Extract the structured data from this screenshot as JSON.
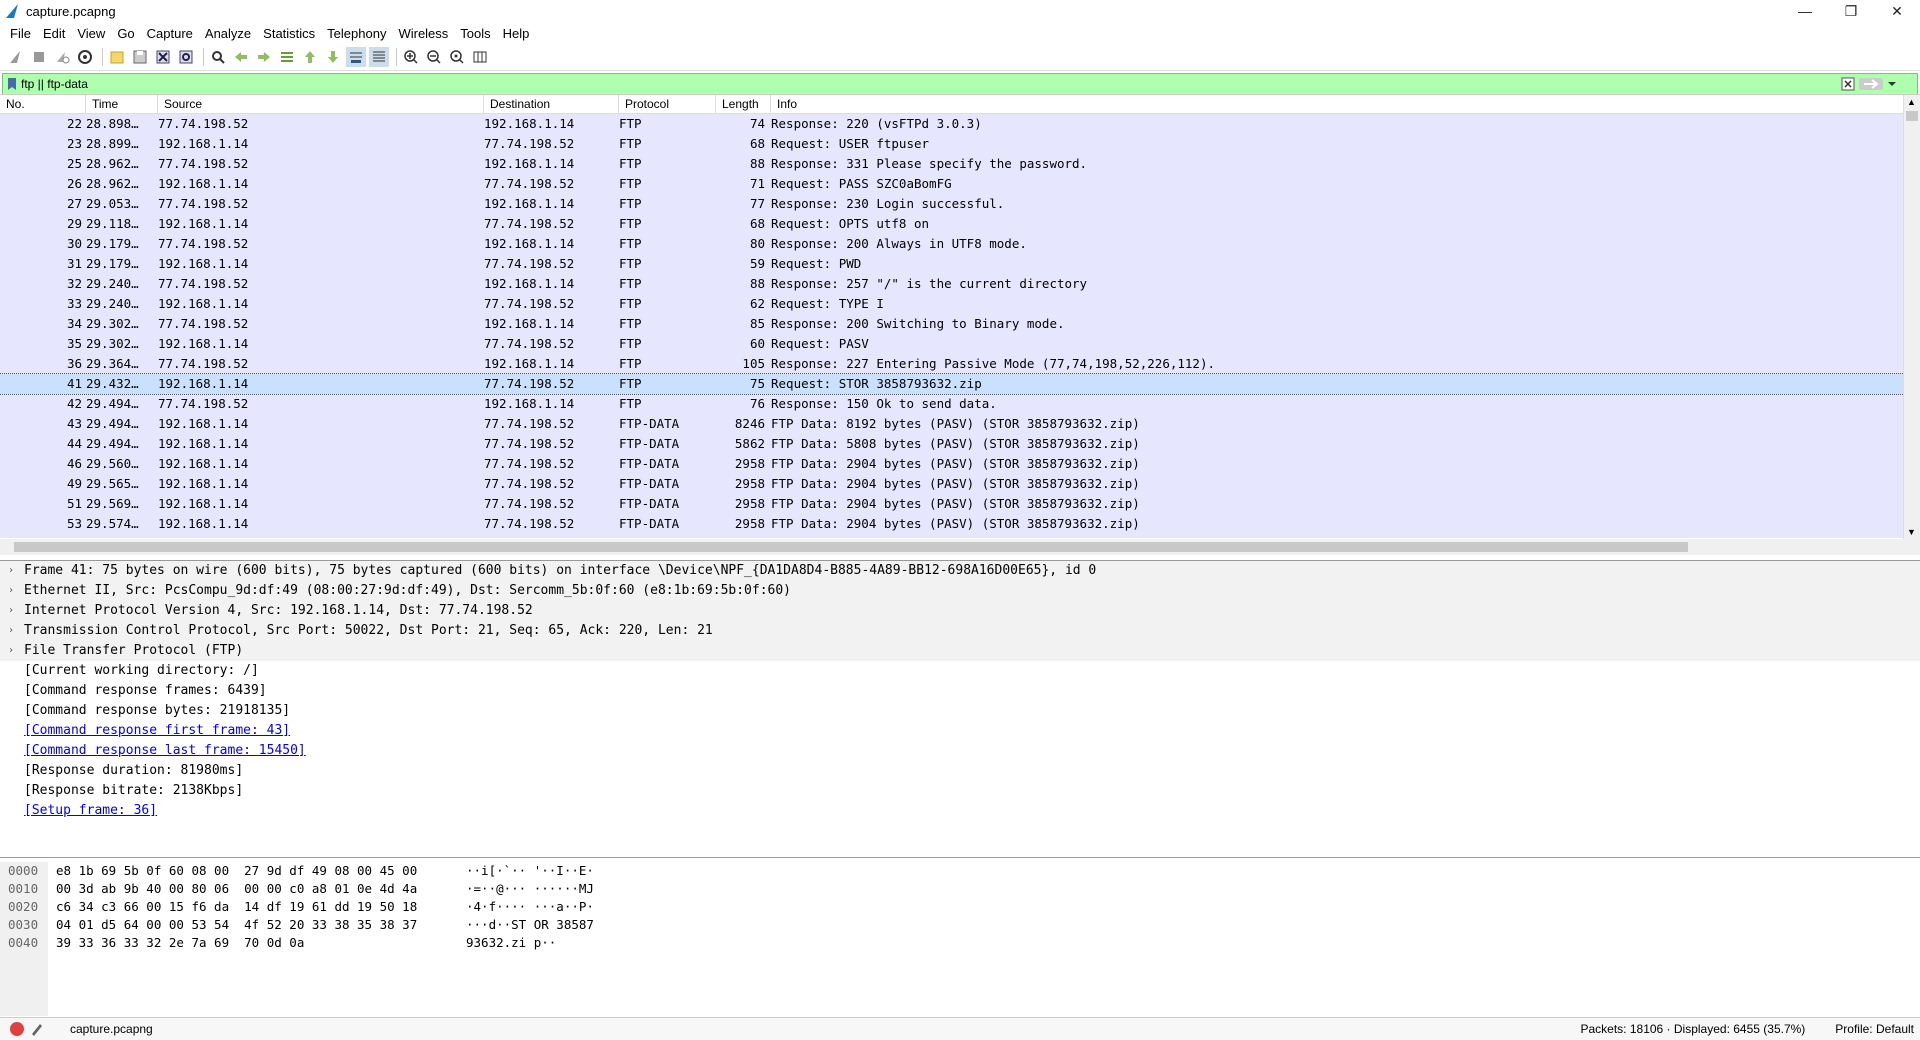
{
  "window": {
    "title": "capture.pcapng",
    "minimize": "—",
    "maximize": "❐",
    "close": "✕"
  },
  "menu": [
    "File",
    "Edit",
    "View",
    "Go",
    "Capture",
    "Analyze",
    "Statistics",
    "Telephony",
    "Wireless",
    "Tools",
    "Help"
  ],
  "filter": {
    "value": "ftp || ftp-data",
    "plus": "+"
  },
  "columns": [
    "No.",
    "Time",
    "Source",
    "Destination",
    "Protocol",
    "Length",
    "Info"
  ],
  "packets": [
    {
      "no": "22",
      "time": "28.898…",
      "src": "77.74.198.52",
      "dst": "192.168.1.14",
      "proto": "FTP",
      "len": "74",
      "info": "Response: 220 (vsFTPd 3.0.3)"
    },
    {
      "no": "23",
      "time": "28.899…",
      "src": "192.168.1.14",
      "dst": "77.74.198.52",
      "proto": "FTP",
      "len": "68",
      "info": "Request: USER ftpuser"
    },
    {
      "no": "25",
      "time": "28.962…",
      "src": "77.74.198.52",
      "dst": "192.168.1.14",
      "proto": "FTP",
      "len": "88",
      "info": "Response: 331 Please specify the password."
    },
    {
      "no": "26",
      "time": "28.962…",
      "src": "192.168.1.14",
      "dst": "77.74.198.52",
      "proto": "FTP",
      "len": "71",
      "info": "Request: PASS SZC0aBomFG"
    },
    {
      "no": "27",
      "time": "29.053…",
      "src": "77.74.198.52",
      "dst": "192.168.1.14",
      "proto": "FTP",
      "len": "77",
      "info": "Response: 230 Login successful."
    },
    {
      "no": "29",
      "time": "29.118…",
      "src": "192.168.1.14",
      "dst": "77.74.198.52",
      "proto": "FTP",
      "len": "68",
      "info": "Request: OPTS utf8 on"
    },
    {
      "no": "30",
      "time": "29.179…",
      "src": "77.74.198.52",
      "dst": "192.168.1.14",
      "proto": "FTP",
      "len": "80",
      "info": "Response: 200 Always in UTF8 mode."
    },
    {
      "no": "31",
      "time": "29.179…",
      "src": "192.168.1.14",
      "dst": "77.74.198.52",
      "proto": "FTP",
      "len": "59",
      "info": "Request: PWD"
    },
    {
      "no": "32",
      "time": "29.240…",
      "src": "77.74.198.52",
      "dst": "192.168.1.14",
      "proto": "FTP",
      "len": "88",
      "info": "Response: 257 \"/\" is the current directory"
    },
    {
      "no": "33",
      "time": "29.240…",
      "src": "192.168.1.14",
      "dst": "77.74.198.52",
      "proto": "FTP",
      "len": "62",
      "info": "Request: TYPE I"
    },
    {
      "no": "34",
      "time": "29.302…",
      "src": "77.74.198.52",
      "dst": "192.168.1.14",
      "proto": "FTP",
      "len": "85",
      "info": "Response: 200 Switching to Binary mode."
    },
    {
      "no": "35",
      "time": "29.302…",
      "src": "192.168.1.14",
      "dst": "77.74.198.52",
      "proto": "FTP",
      "len": "60",
      "info": "Request: PASV"
    },
    {
      "no": "36",
      "time": "29.364…",
      "src": "77.74.198.52",
      "dst": "192.168.1.14",
      "proto": "FTP",
      "len": "105",
      "info": "Response: 227 Entering Passive Mode (77,74,198,52,226,112)."
    },
    {
      "no": "41",
      "time": "29.432…",
      "src": "192.168.1.14",
      "dst": "77.74.198.52",
      "proto": "FTP",
      "len": "75",
      "info": "Request: STOR 3858793632.zip"
    },
    {
      "no": "42",
      "time": "29.494…",
      "src": "77.74.198.52",
      "dst": "192.168.1.14",
      "proto": "FTP",
      "len": "76",
      "info": "Response: 150 Ok to send data."
    },
    {
      "no": "43",
      "time": "29.494…",
      "src": "192.168.1.14",
      "dst": "77.74.198.52",
      "proto": "FTP-DATA",
      "len": "8246",
      "info": "FTP Data: 8192 bytes (PASV) (STOR 3858793632.zip)"
    },
    {
      "no": "44",
      "time": "29.494…",
      "src": "192.168.1.14",
      "dst": "77.74.198.52",
      "proto": "FTP-DATA",
      "len": "5862",
      "info": "FTP Data: 5808 bytes (PASV) (STOR 3858793632.zip)"
    },
    {
      "no": "46",
      "time": "29.560…",
      "src": "192.168.1.14",
      "dst": "77.74.198.52",
      "proto": "FTP-DATA",
      "len": "2958",
      "info": "FTP Data: 2904 bytes (PASV) (STOR 3858793632.zip)"
    },
    {
      "no": "49",
      "time": "29.565…",
      "src": "192.168.1.14",
      "dst": "77.74.198.52",
      "proto": "FTP-DATA",
      "len": "2958",
      "info": "FTP Data: 2904 bytes (PASV) (STOR 3858793632.zip)"
    },
    {
      "no": "51",
      "time": "29.569…",
      "src": "192.168.1.14",
      "dst": "77.74.198.52",
      "proto": "FTP-DATA",
      "len": "2958",
      "info": "FTP Data: 2904 bytes (PASV) (STOR 3858793632.zip)"
    },
    {
      "no": "53",
      "time": "29.574…",
      "src": "192.168.1.14",
      "dst": "77.74.198.52",
      "proto": "FTP-DATA",
      "len": "2958",
      "info": "FTP Data: 2904 bytes (PASV) (STOR 3858793632.zip)"
    }
  ],
  "details": {
    "frame": "Frame 41: 75 bytes on wire (600 bits), 75 bytes captured (600 bits) on interface \\Device\\NPF_{DA1DA8D4-B885-4A89-BB12-698A16D00E65}, id 0",
    "ethernet": "Ethernet II, Src: PcsCompu_9d:df:49 (08:00:27:9d:df:49), Dst: Sercomm_5b:0f:60 (e8:1b:69:5b:0f:60)",
    "ip": "Internet Protocol Version 4, Src: 192.168.1.14, Dst: 77.74.198.52",
    "tcp": "Transmission Control Protocol, Src Port: 50022, Dst Port: 21, Seq: 65, Ack: 220, Len: 21",
    "ftp": "File Transfer Protocol (FTP)",
    "cwd": "[Current working directory: /]",
    "resp_frames": "[Command response frames: 6439]",
    "resp_bytes": "[Command response bytes: 21918135]",
    "first_frame": "[Command response first frame: 43]",
    "last_frame": "[Command response last frame: 15450]",
    "duration": "[Response duration: 81980ms]",
    "bitrate": "[Response bitrate: 2138Kbps]",
    "setup_frame": "[Setup frame: 36]"
  },
  "bytes": {
    "offsets": [
      "0000",
      "0010",
      "0020",
      "0030",
      "0040"
    ],
    "hex": [
      "e8 1b 69 5b 0f 60 08 00  27 9d df 49 08 00 45 00",
      "00 3d ab 9b 40 00 80 06  00 00 c0 a8 01 0e 4d 4a",
      "c6 34 c3 66 00 15 f6 da  14 df 19 61 dd 19 50 18",
      "04 01 d5 64 00 00 53 54  4f 52 20 33 38 35 38 37",
      "39 33 36 33 32 2e 7a 69  70 0d 0a"
    ],
    "ascii": [
      "··i[·`·· '··I··E·",
      "·=··@··· ······MJ",
      "·4·f···· ···a··P·",
      "···d··ST OR 38587",
      "93632.zi p··"
    ]
  },
  "status": {
    "file": "capture.pcapng",
    "packets": "Packets: 18106 · Displayed: 6455 (35.7%)",
    "profile": "Profile: Default"
  },
  "colors": {
    "row_bg": "#e7e6ff",
    "selected_bg": "#c9e1ff",
    "filter_bg": "#afffaf",
    "link": "#0000ee"
  }
}
